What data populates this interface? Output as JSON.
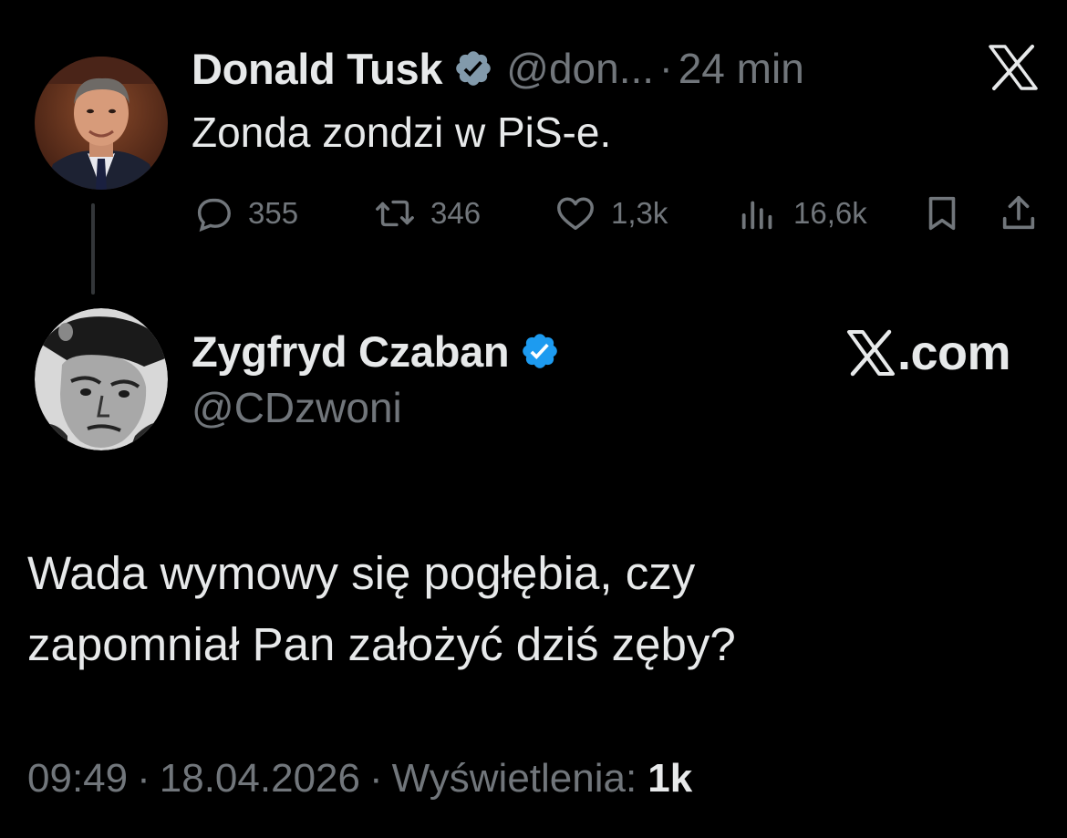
{
  "parent_tweet": {
    "author_name": "Donald Tusk",
    "author_handle": "@don...",
    "separator": "·",
    "time_ago": "24 min",
    "text": "Zonda zondzi w PiS-e.",
    "actions": {
      "replies": "355",
      "reposts": "346",
      "likes": "1,3k",
      "views": "16,6k"
    },
    "icons": [
      "reply-icon",
      "repost-icon",
      "like-icon",
      "views-icon",
      "bookmark-icon",
      "share-icon",
      "x-logo-icon",
      "verified-badge-icon"
    ]
  },
  "reply_tweet": {
    "author_name": "Zygfryd Czaban",
    "author_handle": "@CDzwoni",
    "watermark_text": ".com",
    "text_lines": [
      "Wada wymowy się pogłębia, czy",
      "zapomniał Pan założyć dziś zęby?"
    ],
    "time": "09:49",
    "separator": "·",
    "date": "18.04.2026",
    "views_label": "Wyświetlenia:",
    "views_count": "1k"
  },
  "colors": {
    "background": "#000000",
    "primary_text": "#e7e9ea",
    "secondary_text": "#71767b",
    "verified_grey": "#829aab",
    "verified_blue": "#1d9bf0",
    "thread_line": "#333639"
  }
}
